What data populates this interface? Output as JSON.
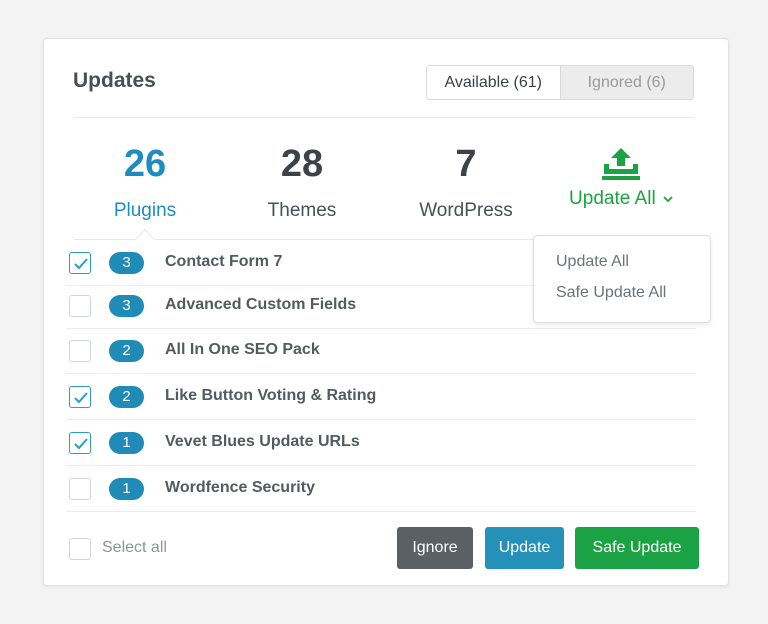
{
  "panel": {
    "title": "Updates",
    "tabs": [
      {
        "label": "Available (61)",
        "active": true
      },
      {
        "label": "Ignored (6)",
        "active": false
      }
    ]
  },
  "stats": [
    {
      "number": "26",
      "label": "Plugins",
      "active": true
    },
    {
      "number": "28",
      "label": "Themes",
      "active": false
    },
    {
      "number": "7",
      "label": "WordPress",
      "active": false
    }
  ],
  "update_all": {
    "label": "Update All",
    "icon": "upload-icon",
    "chevron_icon": "chevron-down-icon",
    "menu": [
      "Update All",
      "Safe Update All"
    ]
  },
  "plugins": [
    {
      "name": "Contact Form 7",
      "count": "3",
      "checked": true
    },
    {
      "name": "Advanced Custom Fields",
      "count": "3",
      "checked": false
    },
    {
      "name": "All In One SEO Pack",
      "count": "2",
      "checked": false
    },
    {
      "name": "Like Button Voting & Rating",
      "count": "2",
      "checked": true
    },
    {
      "name": "Vevet Blues Update URLs",
      "count": "1",
      "checked": true
    },
    {
      "name": "Wordfence Security",
      "count": "1",
      "checked": false
    }
  ],
  "footer": {
    "select_all_label": "Select all",
    "buttons": {
      "ignore": "Ignore",
      "update": "Update",
      "safe_update": "Safe Update"
    }
  },
  "colors": {
    "accent_blue": "#1e8cbe",
    "badge_blue": "#1f8bb6",
    "green": "#1aa244",
    "dark_button": "#5b6066"
  }
}
